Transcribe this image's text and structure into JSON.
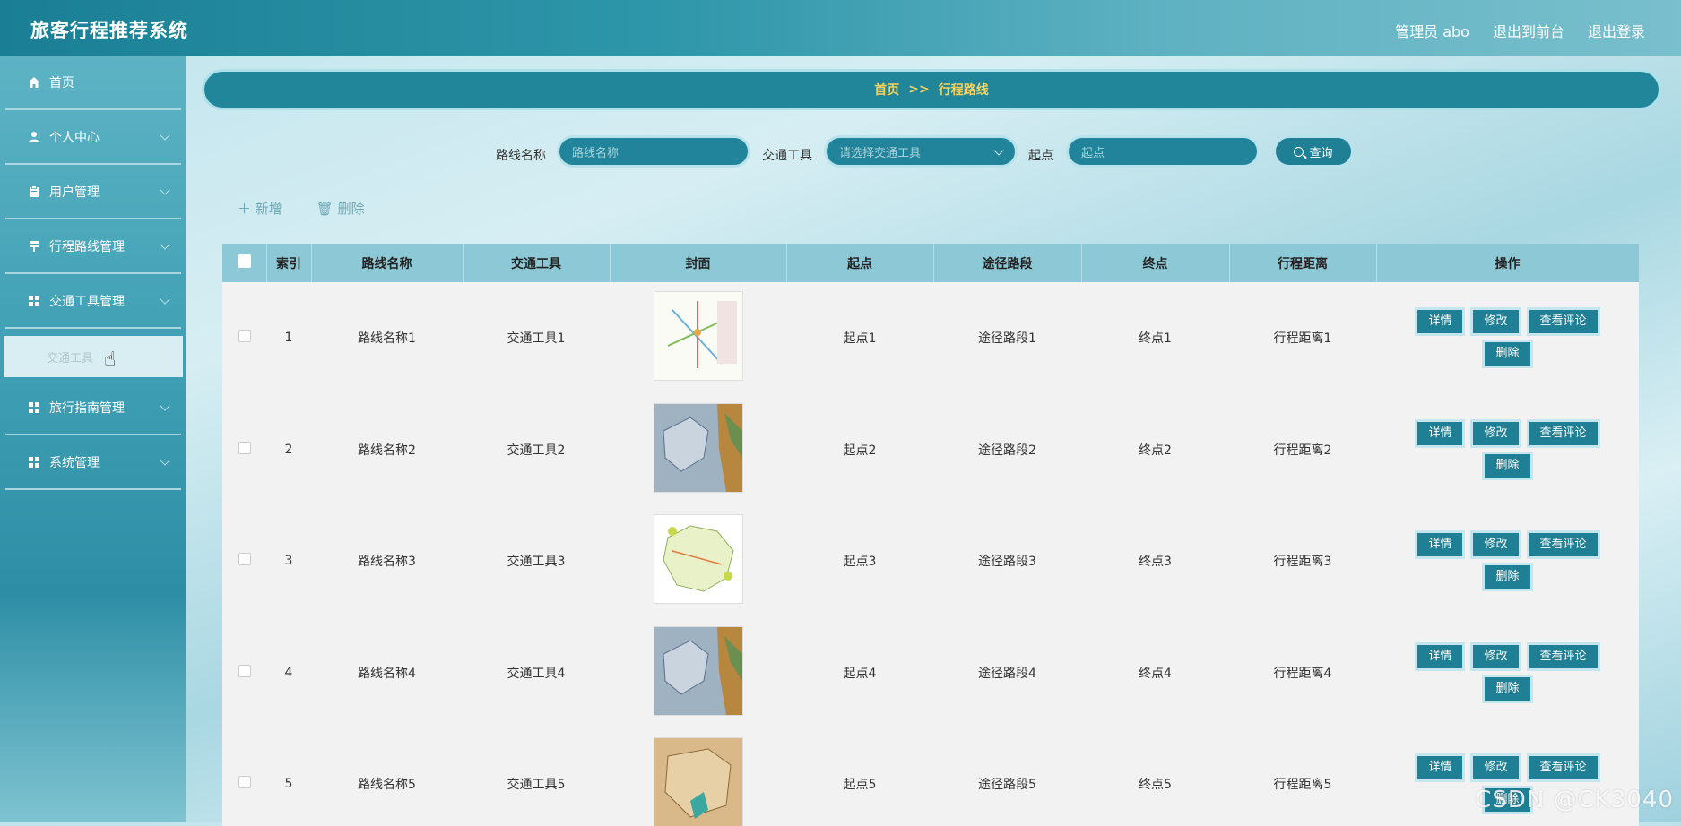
{
  "header": {
    "app_title": "旅客行程推荐系统",
    "admin_label": "管理员 abo",
    "front_link": "退出到前台",
    "logout_link": "退出登录"
  },
  "sidebar": {
    "items": [
      {
        "label": "首页",
        "icon": "home-icon"
      },
      {
        "label": "个人中心",
        "icon": "person-icon"
      },
      {
        "label": "用户管理",
        "icon": "clipboard-icon"
      },
      {
        "label": "行程路线管理",
        "icon": "flag-icon"
      },
      {
        "label": "交通工具管理",
        "icon": "grid-icon"
      },
      {
        "label": "旅行指南管理",
        "icon": "grid-icon"
      },
      {
        "label": "系统管理",
        "icon": "grid-icon"
      }
    ],
    "sub_item": "交通工具"
  },
  "breadcrumb": {
    "home": "首页",
    "sep": ">>",
    "current": "行程路线"
  },
  "search": {
    "route_label": "路线名称",
    "route_placeholder": "路线名称",
    "transport_label": "交通工具",
    "transport_placeholder": "请选择交通工具",
    "start_label": "起点",
    "start_placeholder": "起点",
    "query_button": "查询"
  },
  "toolbar": {
    "add_label": "新增",
    "delete_label": "删除"
  },
  "table": {
    "headers": [
      "索引",
      "路线名称",
      "交通工具",
      "封面",
      "起点",
      "途径路段",
      "终点",
      "行程距离",
      "操作"
    ],
    "rows": [
      {
        "index": "1",
        "name": "路线名称1",
        "transport": "交通工具1",
        "start": "起点1",
        "via": "途径路段1",
        "end": "终点1",
        "distance": "行程距离1"
      },
      {
        "index": "2",
        "name": "路线名称2",
        "transport": "交通工具2",
        "start": "起点2",
        "via": "途径路段2",
        "end": "终点2",
        "distance": "行程距离2"
      },
      {
        "index": "3",
        "name": "路线名称3",
        "transport": "交通工具3",
        "start": "起点3",
        "via": "途径路段3",
        "end": "终点3",
        "distance": "行程距离3"
      },
      {
        "index": "4",
        "name": "路线名称4",
        "transport": "交通工具4",
        "start": "起点4",
        "via": "途径路段4",
        "end": "终点4",
        "distance": "行程距离4"
      },
      {
        "index": "5",
        "name": "路线名称5",
        "transport": "交通工具5",
        "start": "起点5",
        "via": "途径路段5",
        "end": "终点5",
        "distance": "行程距离5"
      }
    ],
    "row_actions": {
      "detail": "详情",
      "edit": "修改",
      "comments": "查看评论",
      "delete": "删除"
    }
  },
  "watermark": "CSDN @CK3040",
  "colors": {
    "accent": "#1f7f94",
    "breadcrumb_text": "#f5d25e",
    "table_header": "#8cc8d5"
  }
}
